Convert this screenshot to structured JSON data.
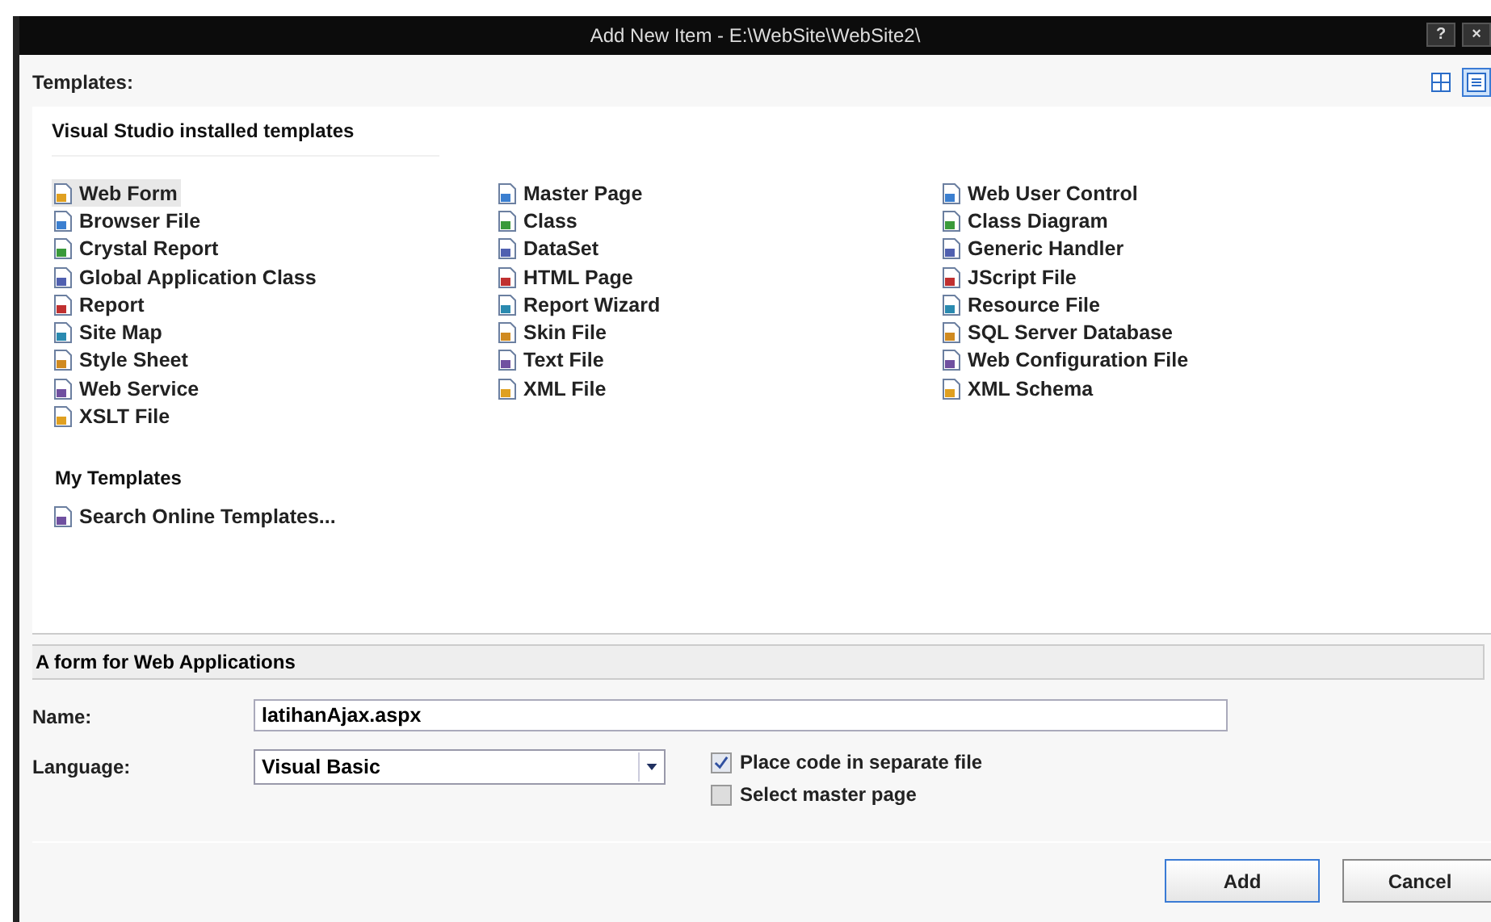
{
  "window": {
    "title": "Add New Item - E:\\WebSite\\WebSite2\\",
    "controls": [
      "?",
      "×"
    ]
  },
  "view_buttons": [
    {
      "selected": false
    },
    {
      "selected": true
    }
  ],
  "templates_label": "Templates:",
  "installed": {
    "header": "Visual Studio installed templates",
    "columns": [
      [
        {
          "label": "Web Form",
          "selected": true
        },
        {
          "label": "Browser File",
          "selected": false
        },
        {
          "label": "Crystal Report",
          "selected": false
        },
        {
          "label": "Global Application Class",
          "selected": false
        },
        {
          "label": "Report",
          "selected": false
        },
        {
          "label": "Site Map",
          "selected": false
        },
        {
          "label": "Style Sheet",
          "selected": false
        },
        {
          "label": "Web Service",
          "selected": false
        },
        {
          "label": "XSLT File",
          "selected": false
        }
      ],
      [
        {
          "label": "Master Page",
          "selected": false
        },
        {
          "label": "Class",
          "selected": false
        },
        {
          "label": "DataSet",
          "selected": false
        },
        {
          "label": "HTML Page",
          "selected": false
        },
        {
          "label": "Report Wizard",
          "selected": false
        },
        {
          "label": "Skin File",
          "selected": false
        },
        {
          "label": "Text File",
          "selected": false
        },
        {
          "label": "XML File",
          "selected": false
        }
      ],
      [
        {
          "label": "Web User Control",
          "selected": false
        },
        {
          "label": "Class Diagram",
          "selected": false
        },
        {
          "label": "Generic Handler",
          "selected": false
        },
        {
          "label": "JScript File",
          "selected": false
        },
        {
          "label": "Resource File",
          "selected": false
        },
        {
          "label": "SQL Server Database",
          "selected": false
        },
        {
          "label": "Web Configuration File",
          "selected": false
        },
        {
          "label": "XML Schema",
          "selected": false
        }
      ]
    ]
  },
  "my_templates": {
    "header": "My Templates",
    "items": [
      {
        "label": "Search Online Templates...",
        "selected": false
      }
    ]
  },
  "description": "A form for Web Applications",
  "name_field": {
    "label": "Name:",
    "value": "latihanAjax.aspx"
  },
  "language_field": {
    "label": "Language:",
    "value": "Visual Basic"
  },
  "options": [
    {
      "label": "Place code in separate file",
      "checked": true
    },
    {
      "label": "Select master page",
      "checked": false
    }
  ],
  "buttons": [
    "Add",
    "Cancel"
  ]
}
